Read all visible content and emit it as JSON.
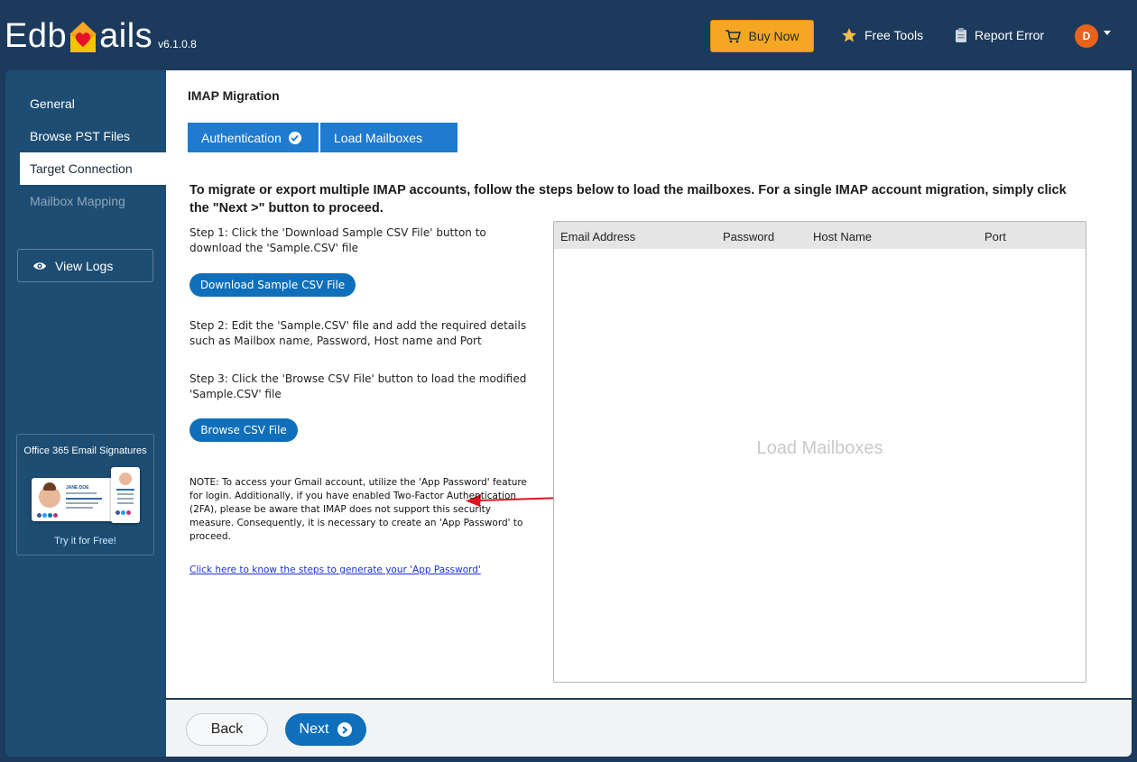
{
  "header": {
    "logo_left": "Edb",
    "logo_right": "ails",
    "version": "v6.1.0.8",
    "buy_now": "Buy Now",
    "free_tools": "Free Tools",
    "report_error": "Report Error",
    "avatar_initial": "D"
  },
  "sidebar": {
    "items": [
      {
        "label": "General",
        "state": "normal"
      },
      {
        "label": "Browse PST Files",
        "state": "normal"
      },
      {
        "label": "Target Connection",
        "state": "active"
      },
      {
        "label": "Mailbox Mapping",
        "state": "disabled"
      }
    ],
    "view_logs": "View Logs",
    "promo": {
      "title": "Office 365 Email Signatures",
      "card_name": "JANE DOE",
      "cta": "Try it for Free!"
    }
  },
  "main": {
    "title": "IMAP Migration",
    "tabs": [
      {
        "label": "Authentication",
        "completed": true
      },
      {
        "label": "Load Mailboxes",
        "completed": false
      }
    ],
    "intro": "To migrate or export multiple IMAP accounts, follow the steps below to load the mailboxes. For a single IMAP account migration, simply click the \"Next >\" button to proceed.",
    "step1": "Step 1: Click the 'Download Sample CSV File' button to download the 'Sample.CSV' file",
    "download_btn": "Download Sample CSV File",
    "step2": "Step 2: Edit the 'Sample.CSV' file and add the required details such as Mailbox name, Password, Host name and Port",
    "step3": "Step 3: Click the 'Browse CSV File' button to load the modified 'Sample.CSV' file",
    "browse_btn": "Browse CSV File",
    "note": "NOTE: To access your Gmail account, utilize the 'App Password' feature for login. Additionally, if you have enabled Two-Factor Authentication (2FA), please be aware that IMAP does not support this security measure. Consequently, it is necessary to create an 'App Password' to proceed.",
    "help_link": "Click here to know the steps to generate your 'App Password'",
    "grid": {
      "columns": [
        "Email Address",
        "Password",
        "Host Name",
        "Port"
      ],
      "empty_text": "Load Mailboxes"
    }
  },
  "footer": {
    "back": "Back",
    "next": "Next"
  },
  "colors": {
    "header_bg": "#1c3a5c",
    "sidebar_bg": "#1d4d73",
    "primary_blue": "#0f6fba",
    "tab_blue": "#1e7bd0",
    "buy_orange": "#f5a623",
    "avatar_orange": "#e8631c",
    "annotation_arrow": "#e0141e"
  }
}
